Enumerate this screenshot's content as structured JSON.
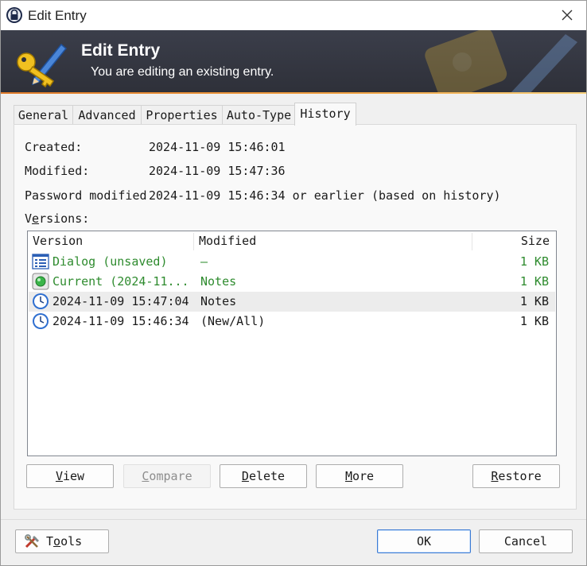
{
  "window": {
    "title": "Edit Entry"
  },
  "banner": {
    "title": "Edit Entry",
    "subtitle": "You are editing an existing entry."
  },
  "tabs": [
    {
      "label": "General"
    },
    {
      "label": "Advanced"
    },
    {
      "label": "Properties"
    },
    {
      "label": "Auto-Type"
    },
    {
      "label": "History",
      "active": true
    }
  ],
  "history": {
    "created_label": "Created:",
    "created_value": "2024-11-09 15:46:01",
    "modified_label": "Modified:",
    "modified_value": "2024-11-09 15:47:36",
    "pwmod_label": "Password modified",
    "pwmod_value": "2024-11-09 15:46:34 or earlier (based on history)",
    "versions_label_pre": "V",
    "versions_label_mn": "e",
    "versions_label_post": "rsions:",
    "columns": {
      "version": "Version",
      "modified": "Modified",
      "size": "Size"
    },
    "rows": [
      {
        "icon": "list-icon",
        "version": "Dialog (unsaved)",
        "modified": "—",
        "size": "1 KB",
        "color": "#2e8b2e"
      },
      {
        "icon": "green-dot-icon",
        "version": "Current (2024-11...",
        "modified": "Notes",
        "size": "1 KB",
        "color": "#2e8b2e"
      },
      {
        "icon": "clock-icon",
        "version": "2024-11-09 15:47:04",
        "modified": "Notes",
        "size": "1 KB",
        "selected": true
      },
      {
        "icon": "clock-icon",
        "version": "2024-11-09 15:46:34",
        "modified": "(New/All)",
        "size": "1 KB"
      }
    ],
    "buttons": {
      "view_mn": "V",
      "view_rest": "iew",
      "compare_mn": "C",
      "compare_rest": "ompare",
      "delete_mn": "D",
      "delete_rest": "elete",
      "more_mn": "M",
      "more_rest": "ore",
      "restore_mn": "R",
      "restore_rest": "estore"
    }
  },
  "footer": {
    "tools_pre": "T",
    "tools_mn": "o",
    "tools_post": "ols",
    "ok_label": "OK",
    "cancel_label": "Cancel"
  }
}
